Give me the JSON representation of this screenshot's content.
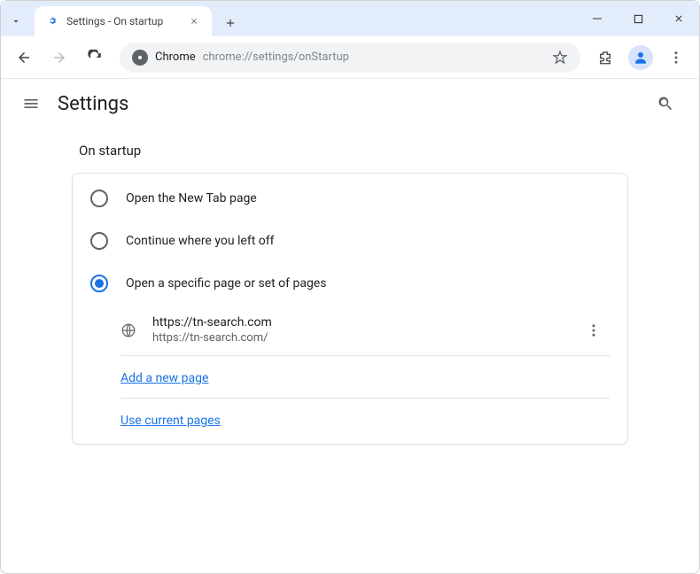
{
  "window": {
    "tab_title": "Settings - On startup"
  },
  "toolbar": {
    "chrome_label": "Chrome",
    "url": "chrome://settings/onStartup"
  },
  "header": {
    "title": "Settings"
  },
  "main": {
    "section_title": "On startup",
    "options": [
      {
        "label": "Open the New Tab page",
        "selected": false
      },
      {
        "label": "Continue where you left off",
        "selected": false
      },
      {
        "label": "Open a specific page or set of pages",
        "selected": true
      }
    ],
    "pages": [
      {
        "name": "https://tn-search.com",
        "url": "https://tn-search.com/"
      }
    ],
    "add_page_label": "Add a new page",
    "use_current_label": "Use current pages"
  }
}
